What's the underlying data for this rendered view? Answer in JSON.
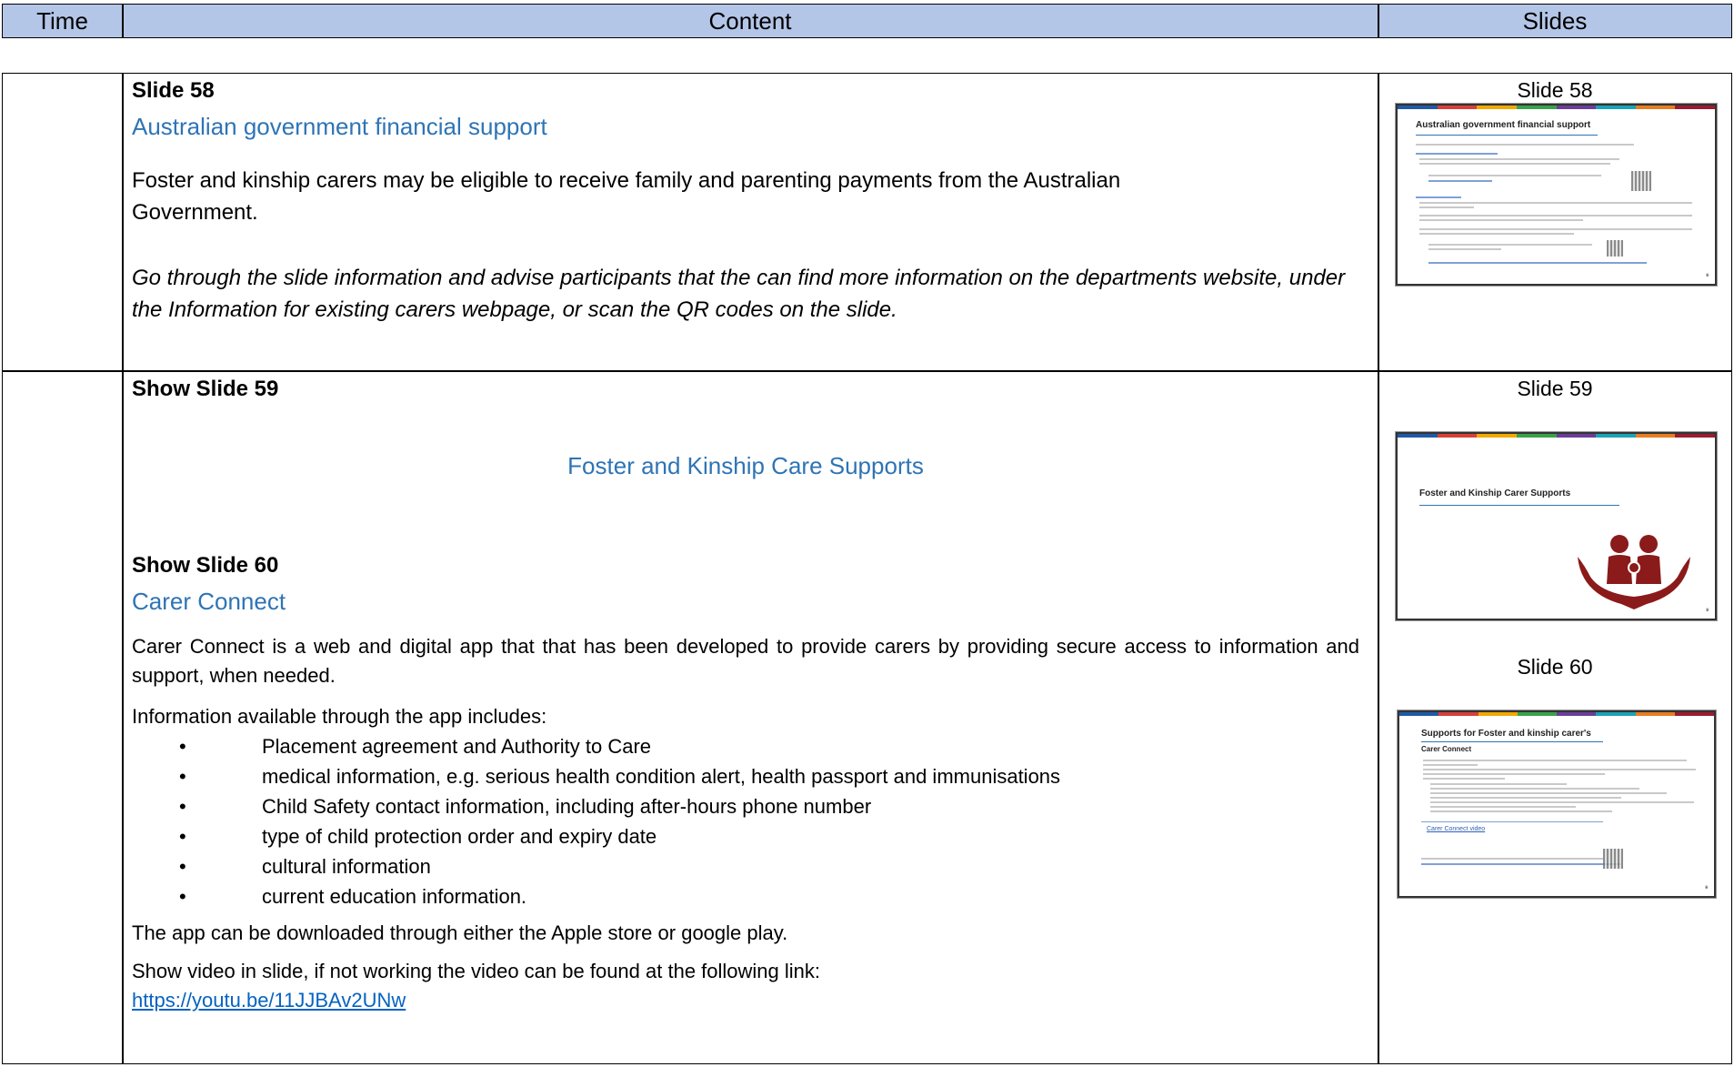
{
  "header": {
    "time": "Time",
    "content": "Content",
    "slides": "Slides"
  },
  "row1": {
    "heading": "Slide 58",
    "subheading": "Australian government financial support",
    "para1": "Foster and kinship carers may be eligible to receive family and parenting payments from the Australian Government.",
    "para2": "Go through the slide information and advise participants that the can find more information on the departments website, under the Information for existing carers webpage, or scan the QR codes on the slide.",
    "slide_label": "Slide 58",
    "thumb_title": "Australian government financial support"
  },
  "row2": {
    "heading1": "Show Slide 59",
    "center_title": "Foster and Kinship Care Supports",
    "heading2": "Show Slide 60",
    "subheading": "Carer Connect",
    "para1": "Carer Connect is a web and digital app that that has been developed to provide carers by providing secure access to information and support, when needed.",
    "para2": "Information available through the app includes:",
    "bullets": [
      "Placement agreement and Authority to Care",
      "medical information, e.g. serious health condition alert, health passport and immunisations",
      "Child Safety contact information, including after-hours phone number",
      "type of child protection order and expiry date",
      "cultural information",
      "current education information."
    ],
    "bullet_char": "•",
    "para3": "The app can be downloaded through either the Apple store or google play.",
    "para4": "Show video in slide, if not working the video can be found at the following link:",
    "link": "https://youtu.be/11JJBAv2UNw",
    "slide59_label": "Slide 59",
    "slide60_label": "Slide 60",
    "thumb59_title": "Foster and Kinship Carer Supports",
    "thumb60_title": "Supports for Foster and kinship carer's",
    "thumb60_sub": "Carer Connect",
    "thumb60_link": "Carer Connect video"
  },
  "colors": {
    "header_bg": "#b4c6e7",
    "heading_blue": "#2e74b5",
    "link_blue": "#0563c1",
    "icon_red": "#8b1a1a",
    "stripe": [
      "#1f5aa6",
      "#d7403a",
      "#f2a900",
      "#3aa24a",
      "#6a3d9a",
      "#1aa3b5",
      "#e67e22",
      "#9b1b30"
    ]
  }
}
